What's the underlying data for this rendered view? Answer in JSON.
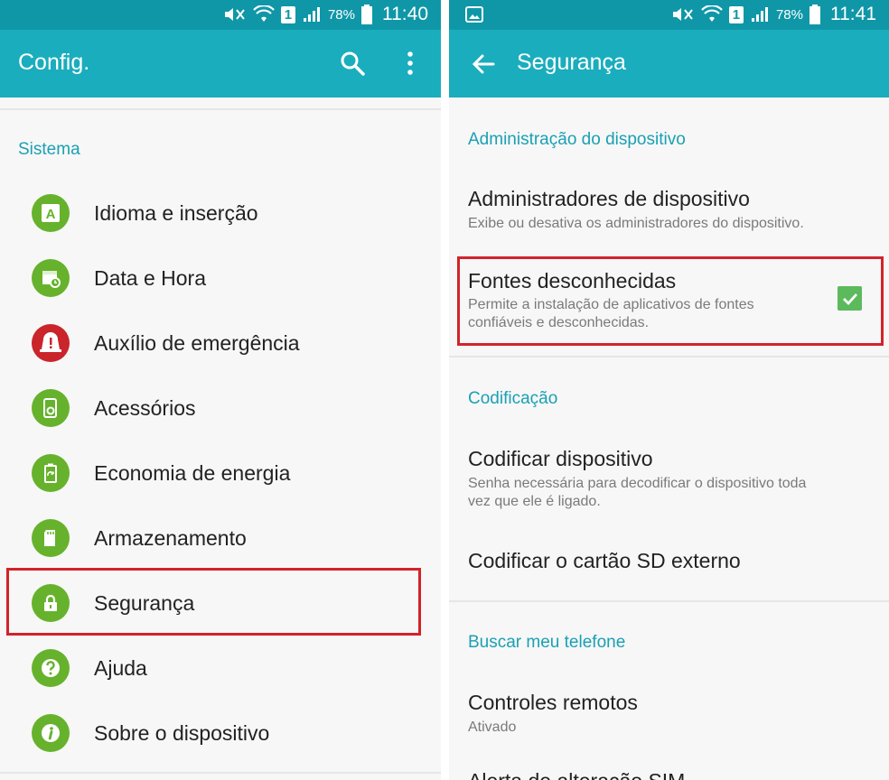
{
  "left": {
    "status": {
      "battery": "78%",
      "time": "11:40",
      "sim": "1"
    },
    "appbar": {
      "title": "Config."
    },
    "section": "Sistema",
    "items": [
      {
        "label": "Idioma e inserção",
        "icon": "language-icon"
      },
      {
        "label": "Data e Hora",
        "icon": "calendar-clock-icon"
      },
      {
        "label": "Auxílio de emergência",
        "icon": "emergency-icon"
      },
      {
        "label": "Acessórios",
        "icon": "accessories-icon"
      },
      {
        "label": "Economia de energia",
        "icon": "power-saving-icon"
      },
      {
        "label": "Armazenamento",
        "icon": "storage-icon"
      },
      {
        "label": "Segurança",
        "icon": "lock-icon"
      },
      {
        "label": "Ajuda",
        "icon": "help-icon"
      },
      {
        "label": "Sobre o dispositivo",
        "icon": "info-icon"
      }
    ]
  },
  "right": {
    "status": {
      "battery": "78%",
      "time": "11:41",
      "sim": "1"
    },
    "appbar": {
      "title": "Segurança"
    },
    "sections": {
      "admin": "Administração do dispositivo",
      "encryption": "Codificação",
      "find": "Buscar meu telefone"
    },
    "items": {
      "admins": {
        "title": "Administradores de dispositivo",
        "subtitle": "Exibe ou desativa os administradores do dispositivo."
      },
      "unknown": {
        "title": "Fontes desconhecidas",
        "subtitle1": "Permite a instalação de aplicativos de fontes",
        "subtitle2": "confiáveis e desconhecidas.",
        "checked": true
      },
      "encrypt": {
        "title": "Codificar dispositivo",
        "subtitle1": "Senha necessária para decodificar o dispositivo toda",
        "subtitle2": "vez que ele é ligado."
      },
      "encrypt_sd": {
        "title": "Codificar o cartão SD externo"
      },
      "remote": {
        "title": "Controles remotos",
        "subtitle": "Ativado"
      },
      "sim_alert": {
        "title": "Alerta de alteração SIM"
      }
    }
  },
  "colors": {
    "appbar": "#1aadbd",
    "statusbar": "#0f97a8",
    "accent": "#1aa0b4",
    "icon_green": "#66b22c",
    "icon_red": "#c9252b",
    "highlight": "#d2232a",
    "checkbox": "#5cba5c"
  }
}
